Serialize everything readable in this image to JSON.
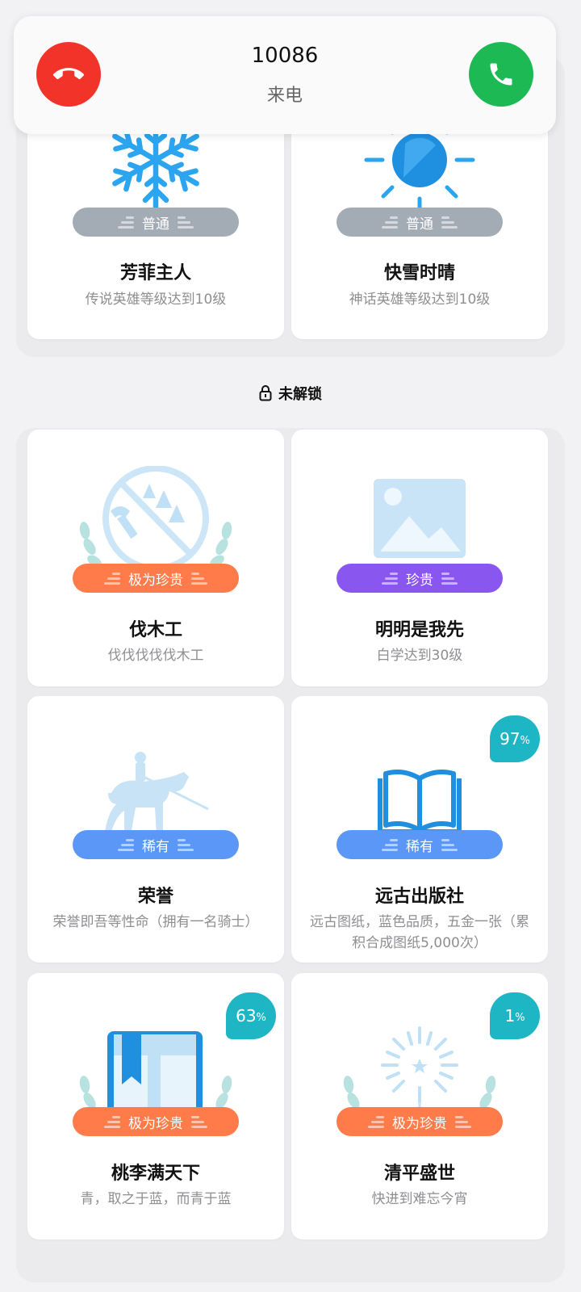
{
  "call": {
    "number": "10086",
    "status": "来电"
  },
  "unlocked_cards": [
    {
      "title": "芳菲主人",
      "desc": "传说英雄等级达到10级",
      "rarity": "普通",
      "icon": "snowflake-icon"
    },
    {
      "title": "快雪时晴",
      "desc": "神话英雄等级达到10级",
      "rarity": "普通",
      "icon": "sun-icon"
    }
  ],
  "locked_section": {
    "label": "未解锁",
    "cards": [
      {
        "title": "伐木工",
        "desc": "伐伐伐伐伐木工",
        "rarity": "极为珍贵",
        "icon": "no-logging-icon"
      },
      {
        "title": "明明是我先",
        "desc": "白学达到30级",
        "rarity": "珍贵",
        "icon": "image-placeholder-icon"
      },
      {
        "title": "荣誉",
        "desc": "荣誉即吾等性命（拥有一名骑士）",
        "rarity": "稀有",
        "icon": "knight-icon"
      },
      {
        "title": "远古出版社",
        "desc": "远古图纸，蓝色品质，五金一张（累积合成图纸5,000次）",
        "rarity": "稀有",
        "icon": "open-book-icon",
        "progress": "97",
        "progress_unit": "%"
      },
      {
        "title": "桃李满天下",
        "desc": "青，取之于蓝，而青于蓝",
        "rarity": "极为珍贵",
        "icon": "bookmark-book-icon",
        "progress": "63",
        "progress_unit": "%"
      },
      {
        "title": "清平盛世",
        "desc": "快进到难忘今宵",
        "rarity": "极为珍贵",
        "icon": "fireworks-icon",
        "progress": "1",
        "progress_unit": "%"
      }
    ]
  },
  "colors": {
    "common": "#a3abb5",
    "rare": "#5b97f7",
    "precious": "#8a56f0",
    "very_precious": "#ff7b4a",
    "progress_bubble": "#1eb5c4",
    "decline": "#f2332a",
    "accept": "#1db954"
  }
}
